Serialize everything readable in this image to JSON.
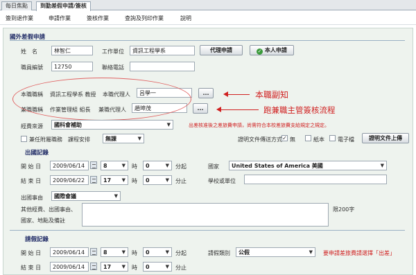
{
  "tabs": [
    {
      "label": "每日焦點"
    },
    {
      "label": "到勤差假申請/簽核"
    }
  ],
  "menu": [
    "簽到退作業",
    "申請作業",
    "簽核作業",
    "查詢及列印作業",
    "說明"
  ],
  "section_title": "國外差假申請",
  "form": {
    "name_label": "姓　名",
    "name_value": "林智仁",
    "unit_label": "工作單位",
    "unit_value": "資訊工程學系",
    "proxy_btn": "代理申請",
    "self_btn": "本人申請",
    "empno_label": "職員編號",
    "empno_value": "12750",
    "phone_label": "聯絡電話",
    "phone_value": "",
    "duty1_label": "本職職稱",
    "duty1_title": "資訊工程學系 教授",
    "duty1_agent_label": "本職代理人",
    "duty1_agent_value": "呂學一",
    "duty2_label": "兼職職稱",
    "duty2_title": "作業管理組 組長",
    "duty2_agent_label": "兼職代理人",
    "duty2_agent_value": "趙坤茂",
    "dots": "...",
    "fund_label": "經費來源",
    "fund_value": "國科會補助",
    "fund_note": "出差核准後之差旅費申請，尚需符合本校差旅費支給規定之規定。",
    "courses_label": "課程安排",
    "courses_value": "無課",
    "affil_label": "兼任附屬職務",
    "doc_label": "證明文件傳送方式",
    "doc_none": "無",
    "doc_paper": "紙本",
    "doc_elec": "電子檔",
    "doc_btn": "證明文件上傳",
    "trip_title": "出國記錄",
    "start_label": "開 始 日",
    "start_date": "2009/06/14",
    "start_hour": "8",
    "start_min": "0",
    "end_label": "結 束 日",
    "end_date": "2009/06/22",
    "end_hour": "17",
    "end_min": "0",
    "hour_unit": "時",
    "start_min_unit": "分起",
    "end_min_unit": "分止",
    "country_label": "國家",
    "country_value": "United States of America 美國",
    "school_label": "學校或單位",
    "school_value": "",
    "reason_label": "出國事由",
    "reason_value": "國際會議",
    "other_label1": "其他經費、出國事由、",
    "other_label2": "國家、地點及備註",
    "limit_note": "限200字",
    "leave_title": "請假記錄",
    "leave_start_label": "開 始 日",
    "leave_start_date": "2009/06/14",
    "leave_start_hour": "8",
    "leave_start_min": "0",
    "leave_end_label": "結 束 日",
    "leave_end_date": "2009/06/14",
    "leave_end_hour": "17",
    "leave_end_min": "0",
    "leave_type_label": "請假類別",
    "leave_type_value": "公假",
    "leave_note": "要申請差旅費請選擇「出差」"
  },
  "annotations": {
    "a1": "本職副知",
    "a2": "跑兼職主管簽核流程"
  },
  "colors": {
    "panel": "#eef3ee",
    "annotation": "#d02020",
    "section": "#202b66"
  }
}
